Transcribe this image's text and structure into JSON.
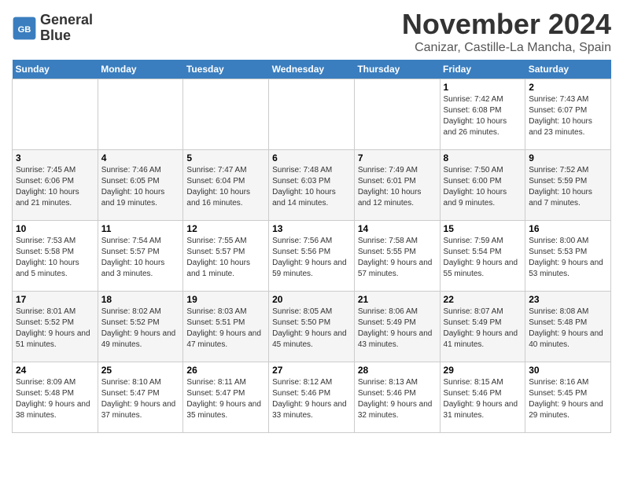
{
  "logo": {
    "text_line1": "General",
    "text_line2": "Blue"
  },
  "title": {
    "month_year": "November 2024",
    "location": "Canizar, Castille-La Mancha, Spain"
  },
  "weekdays": [
    "Sunday",
    "Monday",
    "Tuesday",
    "Wednesday",
    "Thursday",
    "Friday",
    "Saturday"
  ],
  "weeks": [
    [
      {
        "day": "",
        "info": ""
      },
      {
        "day": "",
        "info": ""
      },
      {
        "day": "",
        "info": ""
      },
      {
        "day": "",
        "info": ""
      },
      {
        "day": "",
        "info": ""
      },
      {
        "day": "1",
        "info": "Sunrise: 7:42 AM\nSunset: 6:08 PM\nDaylight: 10 hours and 26 minutes."
      },
      {
        "day": "2",
        "info": "Sunrise: 7:43 AM\nSunset: 6:07 PM\nDaylight: 10 hours and 23 minutes."
      }
    ],
    [
      {
        "day": "3",
        "info": "Sunrise: 7:45 AM\nSunset: 6:06 PM\nDaylight: 10 hours and 21 minutes."
      },
      {
        "day": "4",
        "info": "Sunrise: 7:46 AM\nSunset: 6:05 PM\nDaylight: 10 hours and 19 minutes."
      },
      {
        "day": "5",
        "info": "Sunrise: 7:47 AM\nSunset: 6:04 PM\nDaylight: 10 hours and 16 minutes."
      },
      {
        "day": "6",
        "info": "Sunrise: 7:48 AM\nSunset: 6:03 PM\nDaylight: 10 hours and 14 minutes."
      },
      {
        "day": "7",
        "info": "Sunrise: 7:49 AM\nSunset: 6:01 PM\nDaylight: 10 hours and 12 minutes."
      },
      {
        "day": "8",
        "info": "Sunrise: 7:50 AM\nSunset: 6:00 PM\nDaylight: 10 hours and 9 minutes."
      },
      {
        "day": "9",
        "info": "Sunrise: 7:52 AM\nSunset: 5:59 PM\nDaylight: 10 hours and 7 minutes."
      }
    ],
    [
      {
        "day": "10",
        "info": "Sunrise: 7:53 AM\nSunset: 5:58 PM\nDaylight: 10 hours and 5 minutes."
      },
      {
        "day": "11",
        "info": "Sunrise: 7:54 AM\nSunset: 5:57 PM\nDaylight: 10 hours and 3 minutes."
      },
      {
        "day": "12",
        "info": "Sunrise: 7:55 AM\nSunset: 5:57 PM\nDaylight: 10 hours and 1 minute."
      },
      {
        "day": "13",
        "info": "Sunrise: 7:56 AM\nSunset: 5:56 PM\nDaylight: 9 hours and 59 minutes."
      },
      {
        "day": "14",
        "info": "Sunrise: 7:58 AM\nSunset: 5:55 PM\nDaylight: 9 hours and 57 minutes."
      },
      {
        "day": "15",
        "info": "Sunrise: 7:59 AM\nSunset: 5:54 PM\nDaylight: 9 hours and 55 minutes."
      },
      {
        "day": "16",
        "info": "Sunrise: 8:00 AM\nSunset: 5:53 PM\nDaylight: 9 hours and 53 minutes."
      }
    ],
    [
      {
        "day": "17",
        "info": "Sunrise: 8:01 AM\nSunset: 5:52 PM\nDaylight: 9 hours and 51 minutes."
      },
      {
        "day": "18",
        "info": "Sunrise: 8:02 AM\nSunset: 5:52 PM\nDaylight: 9 hours and 49 minutes."
      },
      {
        "day": "19",
        "info": "Sunrise: 8:03 AM\nSunset: 5:51 PM\nDaylight: 9 hours and 47 minutes."
      },
      {
        "day": "20",
        "info": "Sunrise: 8:05 AM\nSunset: 5:50 PM\nDaylight: 9 hours and 45 minutes."
      },
      {
        "day": "21",
        "info": "Sunrise: 8:06 AM\nSunset: 5:49 PM\nDaylight: 9 hours and 43 minutes."
      },
      {
        "day": "22",
        "info": "Sunrise: 8:07 AM\nSunset: 5:49 PM\nDaylight: 9 hours and 41 minutes."
      },
      {
        "day": "23",
        "info": "Sunrise: 8:08 AM\nSunset: 5:48 PM\nDaylight: 9 hours and 40 minutes."
      }
    ],
    [
      {
        "day": "24",
        "info": "Sunrise: 8:09 AM\nSunset: 5:48 PM\nDaylight: 9 hours and 38 minutes."
      },
      {
        "day": "25",
        "info": "Sunrise: 8:10 AM\nSunset: 5:47 PM\nDaylight: 9 hours and 37 minutes."
      },
      {
        "day": "26",
        "info": "Sunrise: 8:11 AM\nSunset: 5:47 PM\nDaylight: 9 hours and 35 minutes."
      },
      {
        "day": "27",
        "info": "Sunrise: 8:12 AM\nSunset: 5:46 PM\nDaylight: 9 hours and 33 minutes."
      },
      {
        "day": "28",
        "info": "Sunrise: 8:13 AM\nSunset: 5:46 PM\nDaylight: 9 hours and 32 minutes."
      },
      {
        "day": "29",
        "info": "Sunrise: 8:15 AM\nSunset: 5:46 PM\nDaylight: 9 hours and 31 minutes."
      },
      {
        "day": "30",
        "info": "Sunrise: 8:16 AM\nSunset: 5:45 PM\nDaylight: 9 hours and 29 minutes."
      }
    ]
  ]
}
